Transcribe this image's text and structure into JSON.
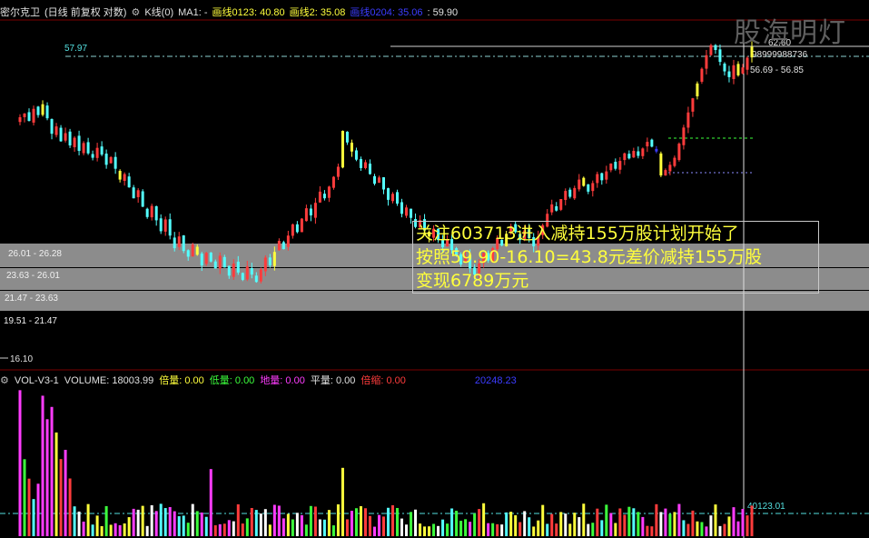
{
  "header": {
    "stock_name": "密尔克卫",
    "mode": "(日线 前复权 对数)",
    "indicator_icon": "gear-icon",
    "kline": "K线(0)",
    "ma1": "MA1: -",
    "line1": "画线0123: 40.80",
    "line2": "画线2: 35.08",
    "line3": "画线0204: 35.06",
    "line4": ": 59.90"
  },
  "watermark": "股海明灯",
  "price_panel": {
    "high_label": "57.97",
    "top_right_label": "62.60",
    "right_label_1": "98999988736",
    "right_label_2": "56.69 - 56.85",
    "bottom_label": "16.10",
    "bands": [
      "26.01 - 26.28",
      "23.63 - 26.01",
      "21.47 - 23.63",
      "19.51 - 21.47"
    ]
  },
  "annotation": {
    "line1": "关注603713进入减持155万股计划开始了",
    "line2": "按照59.90-16.10=43.8元差价减持155万股",
    "line3": " 变现6789万元"
  },
  "volume_header": {
    "name": "VOL-V3-1",
    "volume": "VOLUME: 18003.99",
    "bei": "倍量: 0.00",
    "di": "低量: 0.00",
    "diliang": "地量: 0.00",
    "ping": "平量: 0.00",
    "suo": "倍缩: 0.00",
    "extra": "20248.23"
  },
  "volume_panel": {
    "ma_label": "40123.01"
  },
  "colors": {
    "up": "#ff3c3c",
    "down": "#54ffff",
    "yellow": "#ffff3c",
    "green": "#3cff3c",
    "magenta": "#ff3cff",
    "white": "#ffffff",
    "blue": "#3c3cff"
  },
  "chart_data": {
    "type": "candlestick",
    "price_scale": "log",
    "ylim": [
      16.1,
      62.6
    ],
    "close": [
      44.5,
      45.2,
      43.8,
      46.1,
      44.9,
      47.0,
      44.3,
      41.5,
      42.8,
      40.2,
      41.6,
      39.5,
      40.8,
      38.6,
      39.9,
      38.2,
      37.5,
      39.1,
      38.0,
      36.4,
      37.6,
      35.8,
      34.2,
      35.0,
      33.1,
      31.6,
      32.7,
      30.5,
      29.2,
      30.6,
      28.8,
      27.5,
      28.9,
      27.0,
      25.6,
      26.9,
      25.3,
      24.7,
      26.0,
      24.9,
      23.8,
      25.1,
      24.2,
      23.5,
      24.8,
      23.6,
      22.8,
      24.0,
      23.1,
      22.4,
      23.7,
      22.9,
      22.2,
      23.4,
      24.6,
      23.8,
      25.2,
      26.4,
      25.5,
      27.0,
      28.3,
      27.4,
      29.0,
      30.3,
      29.4,
      31.0,
      32.5,
      31.6,
      33.2,
      34.6,
      36.1,
      42.0,
      40.0,
      38.5,
      37.2,
      35.9,
      36.8,
      35.0,
      33.6,
      34.5,
      32.8,
      31.4,
      32.2,
      30.9,
      29.6,
      30.4,
      29.1,
      28.0,
      28.8,
      27.6,
      26.9,
      27.8,
      26.5,
      25.7,
      26.6,
      25.4,
      24.8,
      23.9,
      24.7,
      23.5,
      22.9,
      24.0,
      25.1,
      24.3,
      25.6,
      26.7,
      25.9,
      27.2,
      28.1,
      27.4,
      26.5,
      27.6,
      26.7,
      25.8,
      26.9,
      28.2,
      29.6,
      30.8,
      30.0,
      31.5,
      32.6,
      31.8,
      33.0,
      34.2,
      33.3,
      32.5,
      33.7,
      35.0,
      34.1,
      35.4,
      36.6,
      35.8,
      37.0,
      38.2,
      37.4,
      38.6,
      37.8,
      39.0,
      40.1,
      39.3,
      38.5,
      34.8,
      35.6,
      36.4,
      37.5,
      39.8,
      42.6,
      45.4,
      48.2,
      51.3,
      54.6,
      57.8,
      60.3,
      59.1,
      56.2,
      54.0,
      52.7,
      55.4,
      53.1,
      54.9,
      57.2,
      59.9
    ],
    "volume_ylim": [
      0,
      190000
    ],
    "volume_ma": 40123.01
  }
}
